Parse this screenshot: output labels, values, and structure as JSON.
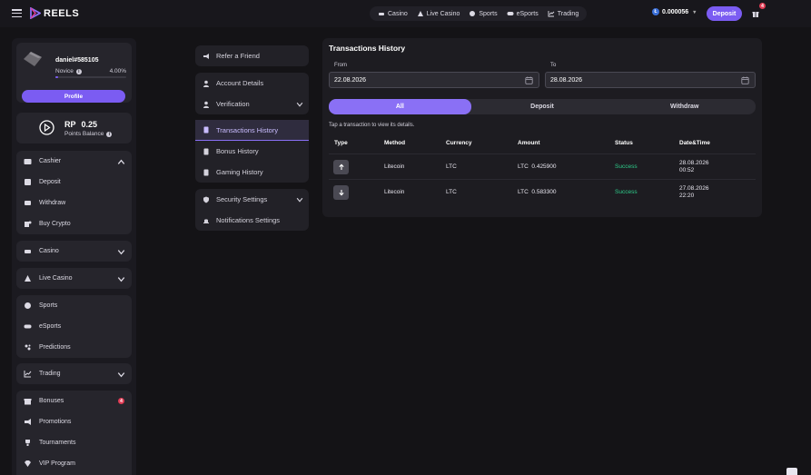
{
  "header": {
    "logo_text": "REELS",
    "nav": [
      {
        "label": "Casino",
        "icon": "casino-icon"
      },
      {
        "label": "Live Casino",
        "icon": "live-casino-icon"
      },
      {
        "label": "Sports",
        "icon": "sports-icon"
      },
      {
        "label": "eSports",
        "icon": "esports-icon"
      },
      {
        "label": "Trading",
        "icon": "trading-icon"
      }
    ],
    "balance": "0.000056",
    "balance_currency_icon": "litecoin-icon",
    "deposit_label": "Deposit",
    "gift_badge": "4"
  },
  "profile": {
    "username": "daniel#585105",
    "rank": "Novice",
    "progress_text": "4.00%",
    "progress_fraction": 0.04,
    "profile_button": "Profile"
  },
  "points": {
    "prefix": "RP",
    "value": "0.25",
    "label": "Points Balance"
  },
  "sidebar": {
    "cashier": {
      "label": "Cashier",
      "items": [
        "Deposit",
        "Withdraw",
        "Buy Crypto"
      ]
    },
    "casino": "Casino",
    "live_casino": "Live Casino",
    "sports_group": [
      "Sports",
      "eSports",
      "Predictions"
    ],
    "trading": "Trading",
    "promo_group": [
      "Bonuses",
      "Promotions",
      "Tournaments",
      "VIP Program"
    ],
    "bonuses_badge": "4"
  },
  "settings_nav": {
    "refer": "Refer a Friend",
    "account_group": [
      "Account Details",
      "Verification"
    ],
    "history_group": [
      "Transactions History",
      "Bonus History",
      "Gaming History"
    ],
    "security_group": [
      "Security Settings",
      "Notifications Settings"
    ]
  },
  "transactions": {
    "title": "Transactions History",
    "from_label": "From",
    "from_value": "22.08.2026",
    "to_label": "To",
    "to_value": "28.08.2026",
    "tabs": [
      "All",
      "Deposit",
      "Withdraw"
    ],
    "active_tab": "All",
    "hint": "Tap a transaction to view its details.",
    "columns": [
      "Type",
      "Method",
      "Currency",
      "Amount",
      "Status",
      "Date&Time"
    ],
    "rows": [
      {
        "direction": "up-arrow-icon",
        "method": "Litecoin",
        "currency": "LTC",
        "amount": "LTC  0.425900",
        "status": "Success",
        "date": "28.08.2026",
        "time": "00:52"
      },
      {
        "direction": "down-arrow-icon",
        "method": "Litecoin",
        "currency": "LTC",
        "amount": "LTC  0.583300",
        "status": "Success",
        "date": "27.08.2026",
        "time": "22:20"
      }
    ]
  },
  "colors": {
    "accent": "#7b5cf2",
    "success": "#2ecc8a",
    "badge": "#e03b54"
  }
}
